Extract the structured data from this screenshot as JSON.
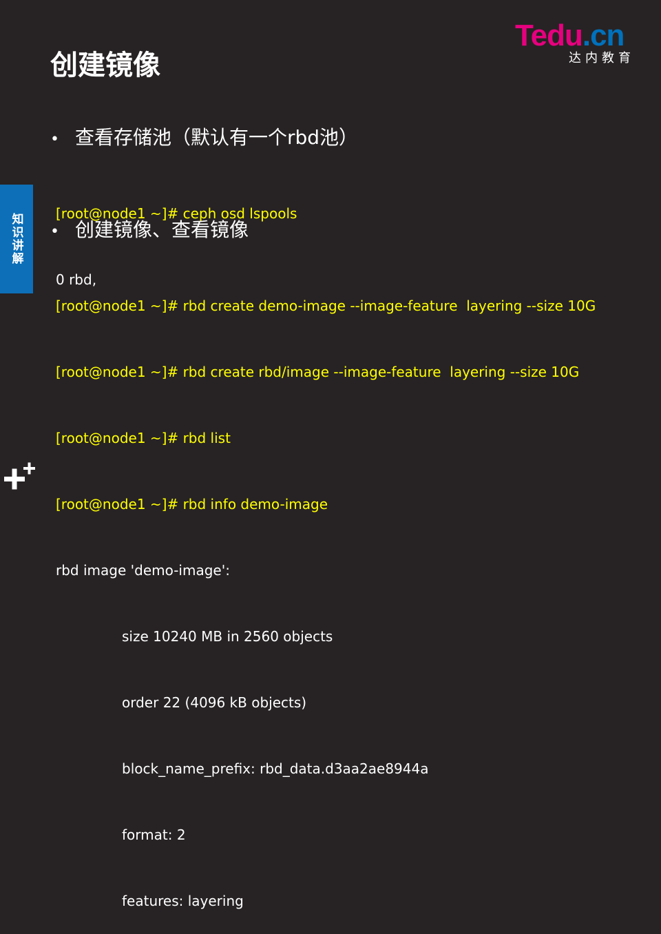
{
  "logo": {
    "brand_main": "Tedu",
    "brand_dot": ".cn",
    "subtitle": "达内教育"
  },
  "title": "创建镜像",
  "side_tab": "知识讲解",
  "bullets": [
    "查看存储池（默认有一个rbd池）",
    "创建镜像、查看镜像"
  ],
  "code_block_1": [
    "[root@node1 ~]# ceph osd lspools",
    "0 rbd,"
  ],
  "code_block_2": {
    "commands": [
      "[root@node1 ~]# rbd create demo-image --image-feature  layering --size 10G",
      "[root@node1 ~]# rbd create rbd/image --image-feature  layering --size 10G",
      "[root@node1 ~]# rbd list",
      "[root@node1 ~]# rbd info demo-image"
    ],
    "output_header": "rbd image 'demo-image':",
    "output_lines": [
      "size 10240 MB in 2560 objects",
      "order 22 (4096 kB objects)",
      "block_name_prefix: rbd_data.d3aa2ae8944a",
      "format: 2",
      "features: layering"
    ]
  },
  "colors": {
    "background": "#272324",
    "command": "#ffff00",
    "accent_blue": "#0d6fb8",
    "brand_pink": "#e6007e"
  },
  "icons": {
    "bottom_left": "plus-icon"
  }
}
